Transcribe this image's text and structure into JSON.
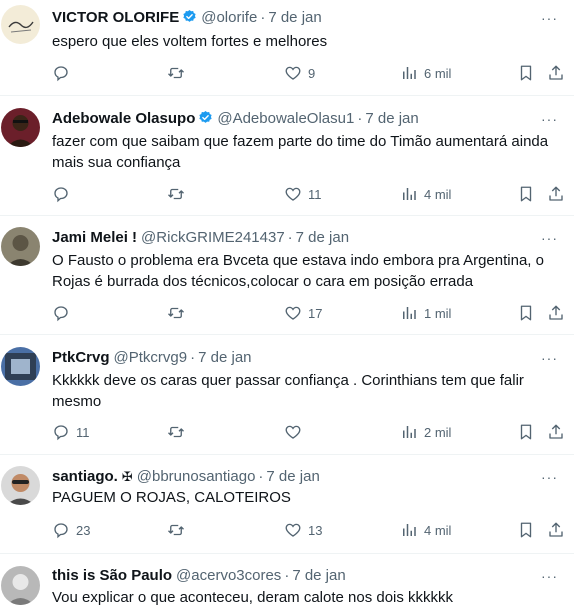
{
  "tweets": [
    {
      "name": "VICTOR OLORIFE",
      "verified": true,
      "handle": "@olorife",
      "time": "7 de jan",
      "text": "espero que eles voltem fortes e melhores",
      "replies": "",
      "retweets": "",
      "likes": "9",
      "views": "6 mil"
    },
    {
      "name": "Adebowale Olasupo",
      "verified": true,
      "handle": "@AdebowaleOlasu1",
      "time": "7 de jan",
      "text": "fazer com que saibam que fazem parte do time do Timão aumentará ainda mais sua confiança",
      "replies": "",
      "retweets": "",
      "likes": "11",
      "views": "4 mil"
    },
    {
      "name": "Jami Melei !",
      "verified": false,
      "handle": "@RickGRIME241437",
      "time": "7 de jan",
      "text": "O Fausto o problema era Bvceta que estava indo embora pra Argentina, o Rojas é burrada dos técnicos,colocar o cara em posição errada",
      "replies": "",
      "retweets": "",
      "likes": "17",
      "views": "1 mil"
    },
    {
      "name": "PtkCrvg",
      "verified": false,
      "handle": "@Ptkcrvg9",
      "time": "7 de jan",
      "text": "Kkkkkk deve os caras quer passar confiança . Corinthians tem que falir mesmo",
      "replies": "11",
      "retweets": "",
      "likes": "",
      "views": "2 mil"
    },
    {
      "name": "santiago.",
      "symbol": "✠",
      "verified": false,
      "handle": "@bbrunosantiago",
      "time": "7 de jan",
      "text": "PAGUEM O ROJAS, CALOTEIROS",
      "replies": "23",
      "retweets": "",
      "likes": "13",
      "views": "4 mil"
    },
    {
      "name": "this is São Paulo",
      "verified": false,
      "handle": "@acervo3cores",
      "time": "7 de jan",
      "text": "Vou explicar o que aconteceu, deram calote nos dois kkkkkk"
    }
  ],
  "icons": {
    "reply": "reply-icon",
    "retweet": "retweet-icon",
    "like": "heart-icon",
    "views": "views-icon",
    "bookmark": "bookmark-icon",
    "share": "share-icon",
    "more": "more-icon"
  },
  "colors": {
    "verified": "#1d9bf0",
    "secondary_text": "#536471",
    "border": "#eff3f4"
  }
}
